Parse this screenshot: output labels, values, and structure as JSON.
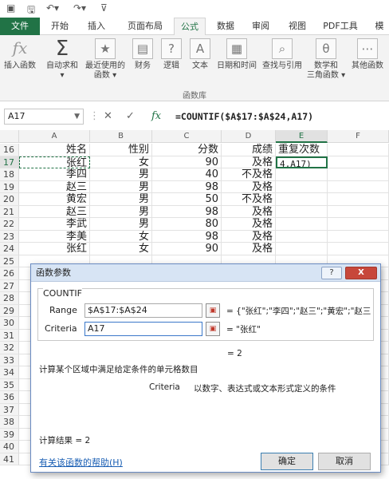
{
  "quick_access": {
    "save_icon": "save-icon",
    "undo_icon": "undo-icon",
    "redo_icon": "redo-icon"
  },
  "tabs": [
    "文件",
    "开始",
    "插入",
    "页面布局",
    "公式",
    "数据",
    "审阅",
    "视图",
    "PDF工具",
    "模"
  ],
  "active_tab": "公式",
  "ribbon": {
    "buttons": [
      {
        "label1": "插入函数",
        "label2": "",
        "icon": "fx"
      },
      {
        "label1": "自动求和",
        "label2": "",
        "icon": "Σ"
      },
      {
        "label1": "最近使用的",
        "label2": "函数",
        "icon": "★"
      },
      {
        "label1": "财务",
        "label2": "",
        "icon": "▤"
      },
      {
        "label1": "逻辑",
        "label2": "",
        "icon": "?"
      },
      {
        "label1": "文本",
        "label2": "",
        "icon": "A"
      },
      {
        "label1": "日期和时间",
        "label2": "",
        "icon": "▦"
      },
      {
        "label1": "查找与引用",
        "label2": "",
        "icon": "⌕"
      },
      {
        "label1": "数学和",
        "label2": "三角函数",
        "icon": "θ"
      },
      {
        "label1": "其他函数",
        "label2": "",
        "icon": "⋯"
      }
    ],
    "group_label": "函数库"
  },
  "formula_bar": {
    "name_box": "A17",
    "cancel": "✕",
    "enter": "✓",
    "fx": "fx",
    "formula": "=COUNTIF($A$17:$A$24,A17)"
  },
  "columns": [
    "A",
    "B",
    "C",
    "D",
    "E",
    "F"
  ],
  "rows": [
    {
      "n": "16",
      "a": "姓名",
      "b": "性别",
      "c": "分数",
      "d": "成绩",
      "e": "重复次数"
    },
    {
      "n": "17",
      "a": "张红",
      "b": "女",
      "c": "90",
      "d": "及格",
      "e": "4,A17)"
    },
    {
      "n": "18",
      "a": "李四",
      "b": "男",
      "c": "40",
      "d": "不及格",
      "e": ""
    },
    {
      "n": "19",
      "a": "赵三",
      "b": "男",
      "c": "98",
      "d": "及格",
      "e": ""
    },
    {
      "n": "20",
      "a": "黄宏",
      "b": "男",
      "c": "50",
      "d": "不及格",
      "e": ""
    },
    {
      "n": "21",
      "a": "赵三",
      "b": "男",
      "c": "98",
      "d": "及格",
      "e": ""
    },
    {
      "n": "22",
      "a": "李武",
      "b": "男",
      "c": "80",
      "d": "及格",
      "e": ""
    },
    {
      "n": "23",
      "a": "李美",
      "b": "女",
      "c": "98",
      "d": "及格",
      "e": ""
    },
    {
      "n": "24",
      "a": "张红",
      "b": "女",
      "c": "90",
      "d": "及格",
      "e": ""
    },
    {
      "n": "25",
      "a": "",
      "b": "",
      "c": "",
      "d": "",
      "e": ""
    },
    {
      "n": "26",
      "a": "",
      "b": "",
      "c": "",
      "d": "",
      "e": ""
    },
    {
      "n": "27",
      "a": "",
      "b": "",
      "c": "",
      "d": "",
      "e": ""
    },
    {
      "n": "28",
      "a": "",
      "b": "",
      "c": "",
      "d": "",
      "e": ""
    },
    {
      "n": "29",
      "a": "",
      "b": "",
      "c": "",
      "d": "",
      "e": ""
    },
    {
      "n": "30",
      "a": "",
      "b": "",
      "c": "",
      "d": "",
      "e": ""
    },
    {
      "n": "31",
      "a": "",
      "b": "",
      "c": "",
      "d": "",
      "e": ""
    },
    {
      "n": "32",
      "a": "",
      "b": "",
      "c": "",
      "d": "",
      "e": ""
    },
    {
      "n": "33",
      "a": "",
      "b": "",
      "c": "",
      "d": "",
      "e": ""
    },
    {
      "n": "34",
      "a": "",
      "b": "",
      "c": "",
      "d": "",
      "e": ""
    },
    {
      "n": "35",
      "a": "",
      "b": "",
      "c": "",
      "d": "",
      "e": ""
    },
    {
      "n": "36",
      "a": "",
      "b": "",
      "c": "",
      "d": "",
      "e": ""
    },
    {
      "n": "37",
      "a": "",
      "b": "",
      "c": "",
      "d": "",
      "e": ""
    },
    {
      "n": "38",
      "a": "",
      "b": "",
      "c": "",
      "d": "",
      "e": ""
    },
    {
      "n": "39",
      "a": "",
      "b": "",
      "c": "",
      "d": "",
      "e": ""
    },
    {
      "n": "40",
      "a": "",
      "b": "",
      "c": "",
      "d": "",
      "e": ""
    },
    {
      "n": "41",
      "a": "",
      "b": "",
      "c": "",
      "d": "",
      "e": ""
    }
  ],
  "dialog": {
    "title": "函数参数",
    "help_btn": "?",
    "close_btn": "X",
    "function_name": "COUNTIF",
    "range_label": "Range",
    "range_value": "$A$17:$A$24",
    "range_result": "= {\"张红\";\"李四\";\"赵三\";\"黄宏\";\"赵三",
    "criteria_label": "Criteria",
    "criteria_value": "A17",
    "criteria_result": "= \"张红\"",
    "formula_result": "= 2",
    "description": "计算某个区域中满足给定条件的单元格数目",
    "param_desc_name": "Criteria",
    "param_desc": "以数字、表达式或文本形式定义的条件",
    "calc_result": "计算结果 =  2",
    "help_link": "有关该函数的帮助(H)",
    "ok": "确定",
    "cancel": "取消"
  }
}
